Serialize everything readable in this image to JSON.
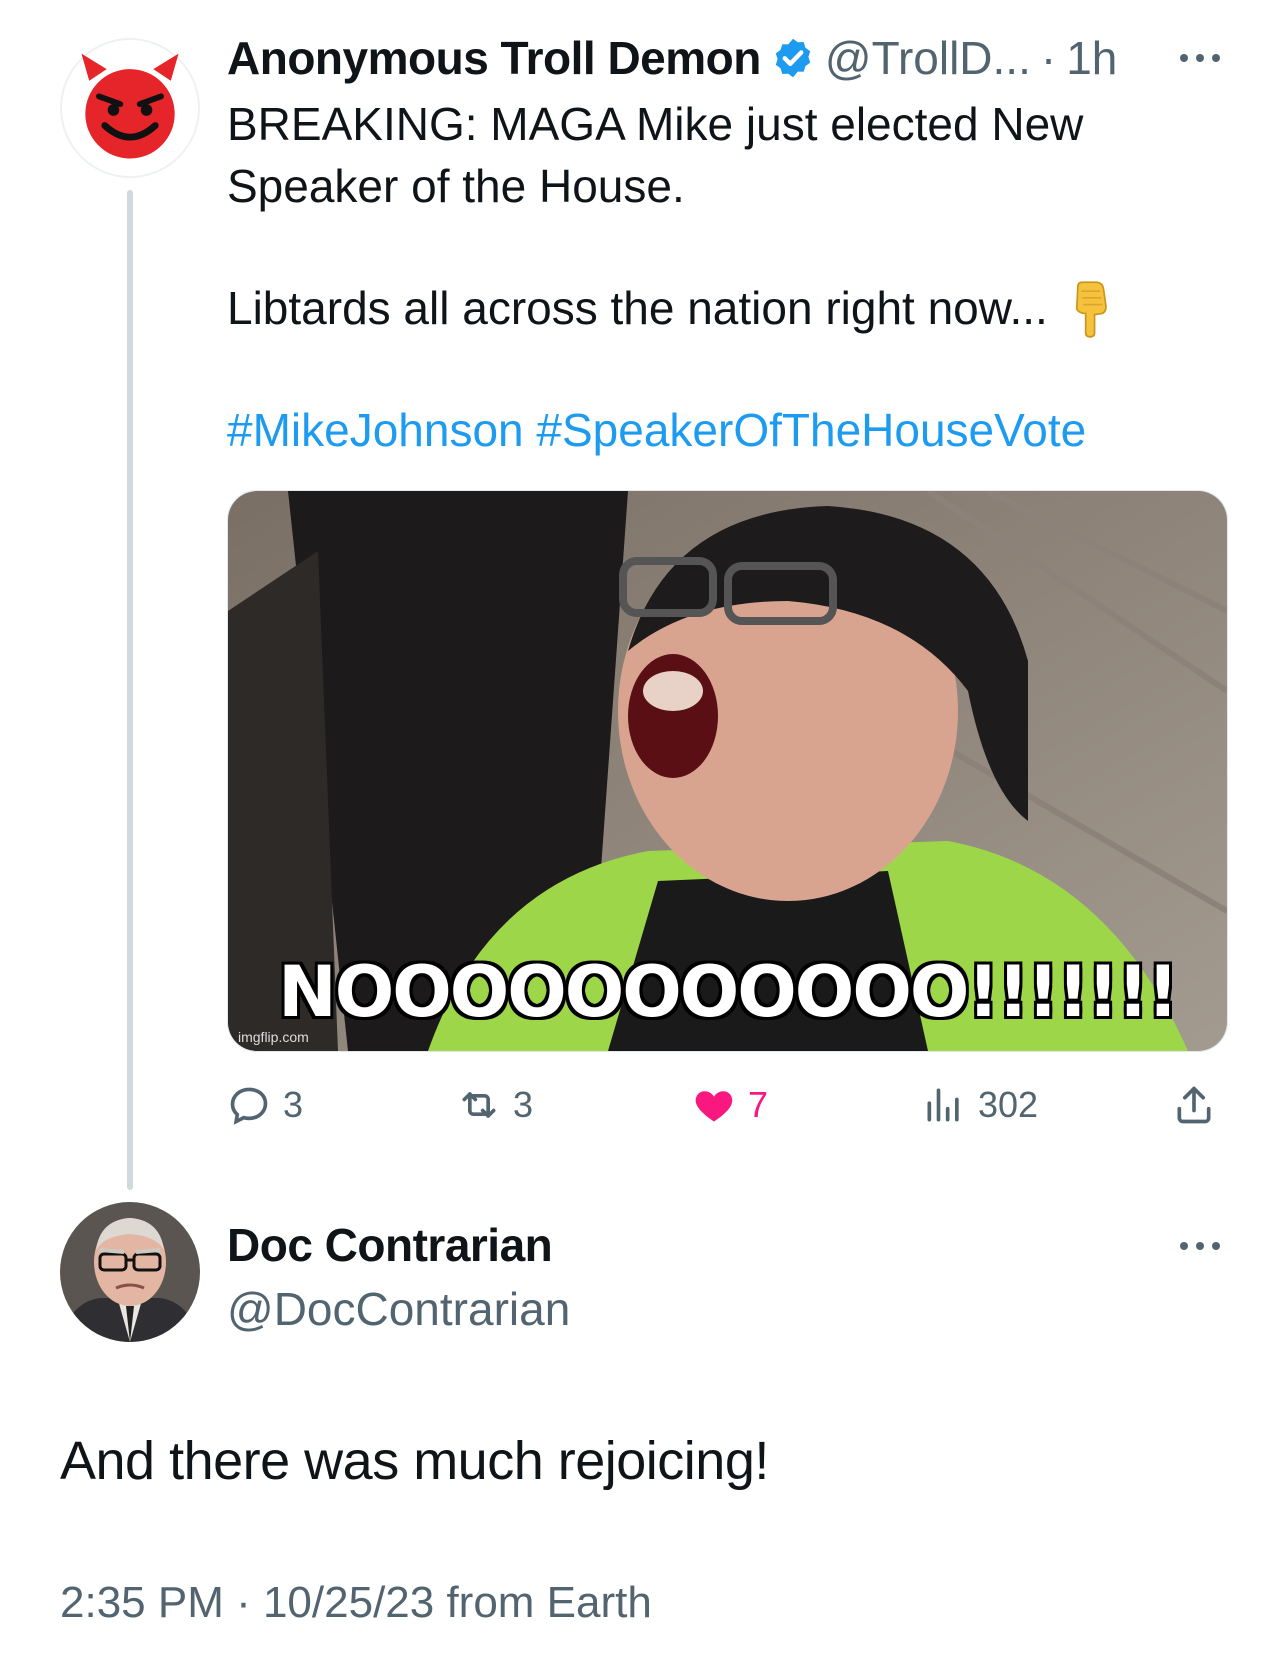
{
  "tweet1": {
    "author_name": "Anonymous Troll Demon",
    "verified_icon": "verified-badge-icon",
    "handle": "@TrollD...",
    "separator": "·",
    "time": "1h",
    "text_line1": "BREAKING: MAGA Mike just elected New",
    "text_line2": "Speaker of the House.",
    "text_line3": "Libtards all across the nation right now...",
    "emoji": "pointing-down-emoji",
    "hashtags": [
      "#MikeJohnson",
      "#SpeakerOfTheHouseVote"
    ],
    "media": {
      "caption": "NOOOOOOOOOOO!!!!!!!",
      "watermark": "imgflip.com"
    },
    "actions": {
      "reply_count": "3",
      "retweet_count": "3",
      "like_count": "7",
      "views_count": "302"
    }
  },
  "tweet2": {
    "author_name": "Doc Contrarian",
    "handle": "@DocContrarian",
    "text": "And there was much rejoicing!",
    "timestamp": "2:35 PM · 10/25/23 from Earth"
  },
  "colors": {
    "link": "#1d9bf0",
    "secondary_text": "#536471",
    "like": "#f91880",
    "verified": "#1d9bf0",
    "thread_line": "#cfd9de"
  }
}
